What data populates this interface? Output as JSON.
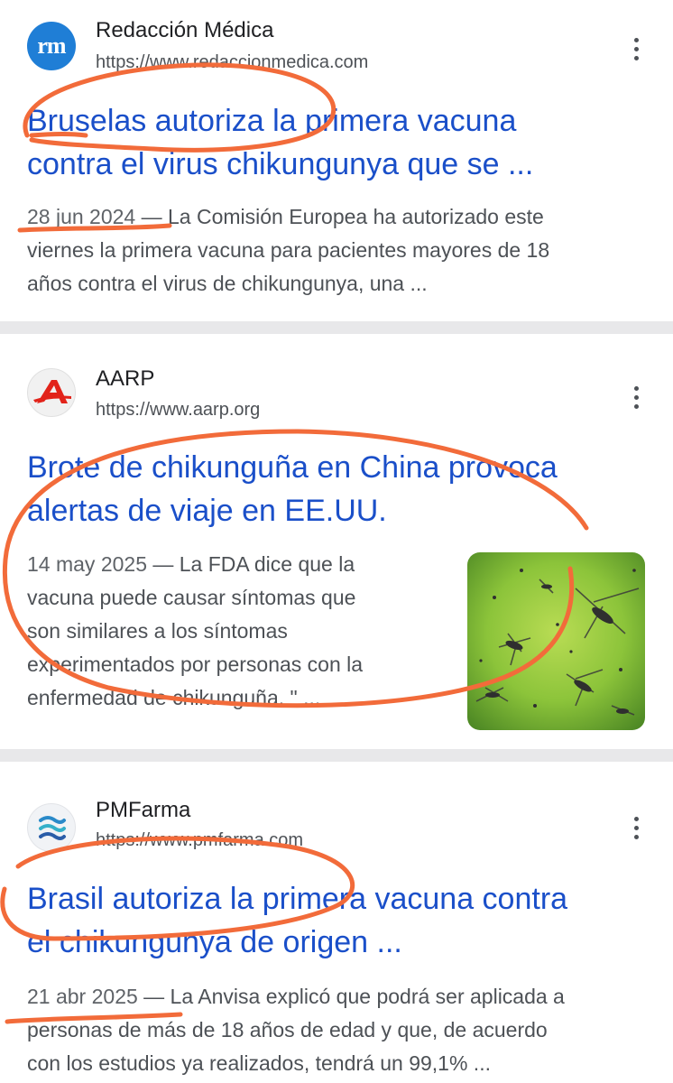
{
  "results": [
    {
      "source": "Redacción Médica",
      "url": "https://www.redaccionmedica.com",
      "favicon_text": "rm",
      "title_line1": "Bruselas autoriza la primera vacuna",
      "title_line2": "contra el virus chikungunya que se ...",
      "date": "28 jun 2024",
      "snippet_line1_rest": " — La Comisión Europea ha autorizado este",
      "snippet_line2": "viernes la primera vacuna para pacientes mayores de 18",
      "snippet_line3": "años contra el virus de chikungunya, una ..."
    },
    {
      "source": "AARP",
      "url": "https://www.aarp.org",
      "favicon_text": "A",
      "title_line1": "Brote de chikunguña en China provoca",
      "title_line2": "alertas de viaje en EE.UU.",
      "date": "14 may 2025",
      "snippet_line1_rest": " — La FDA dice que la",
      "snippet_line2": "vacuna puede causar síntomas que",
      "snippet_line3": "son similares a los síntomas",
      "snippet_line4": "experimentados por personas con la",
      "snippet_line5": "enfermedad de chikunguña. \" ...",
      "thumbnail": "mosquito-swarm-image"
    },
    {
      "source": "PMFarma",
      "url": "https://www.pmfarma.com",
      "title_line1": "Brasil autoriza la primera vacuna contra",
      "title_line2": "el chikungunya de origen ...",
      "date": "21 abr 2025",
      "snippet_line1_rest": " — La Anvisa explicó que podrá ser aplicada a",
      "snippet_line2": "personas de más de 18 años de edad y que, de acuerdo",
      "snippet_line3": "con los estudios ya realizados, tendrá un 99,1% ..."
    }
  ],
  "colors": {
    "title_link": "#1a4fc9",
    "annotation": "#f26b3a",
    "separator": "#e8e8ea"
  },
  "icons": [
    "more-vert-icon",
    "favicon-rm",
    "favicon-aarp",
    "favicon-pmfarma"
  ]
}
